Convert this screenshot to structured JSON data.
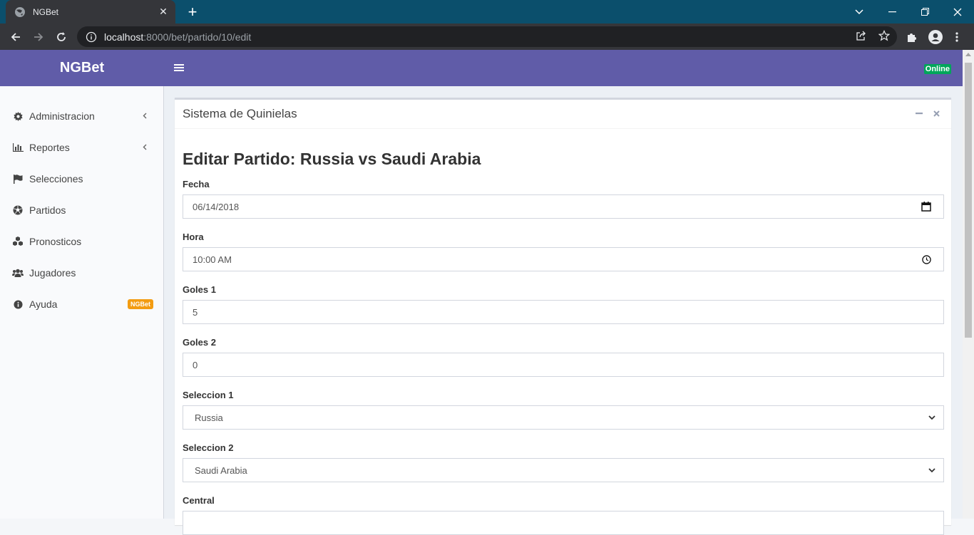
{
  "browser": {
    "tab_title": "NGBet",
    "tab_close": "✕",
    "new_tab": "+",
    "url_host": "localhost",
    "url_rest": ":8000/bet/partido/10/edit"
  },
  "app": {
    "brand": "NGBet",
    "status": "Online"
  },
  "sidebar": {
    "items": [
      {
        "label": "Administracion",
        "icon": "gear-icon",
        "has_submenu": true
      },
      {
        "label": "Reportes",
        "icon": "bar-chart-icon",
        "has_submenu": true
      },
      {
        "label": "Selecciones",
        "icon": "flag-icon",
        "has_submenu": false
      },
      {
        "label": "Partidos",
        "icon": "soccer-ball-icon",
        "has_submenu": false
      },
      {
        "label": "Pronosticos",
        "icon": "cubes-icon",
        "has_submenu": false
      },
      {
        "label": "Jugadores",
        "icon": "users-icon",
        "has_submenu": false
      },
      {
        "label": "Ayuda",
        "icon": "info-icon",
        "badge": "NGBet"
      }
    ]
  },
  "box": {
    "title": "Sistema de Quinielas"
  },
  "form": {
    "heading": "Editar Partido: Russia vs Saudi Arabia",
    "fields": [
      {
        "label": "Fecha",
        "value": "06/14/2018"
      },
      {
        "label": "Hora",
        "value": "10:00 AM"
      },
      {
        "label": "Goles 1",
        "value": "5"
      },
      {
        "label": "Goles 2",
        "value": "0"
      },
      {
        "label": "Seleccion 1",
        "value": "Russia"
      },
      {
        "label": "Seleccion 2",
        "value": "Saudi Arabia"
      },
      {
        "label": "Central",
        "value": ""
      }
    ]
  },
  "colors": {
    "header": "#605ca8",
    "online": "#00a65a",
    "badge": "#f39c12"
  }
}
